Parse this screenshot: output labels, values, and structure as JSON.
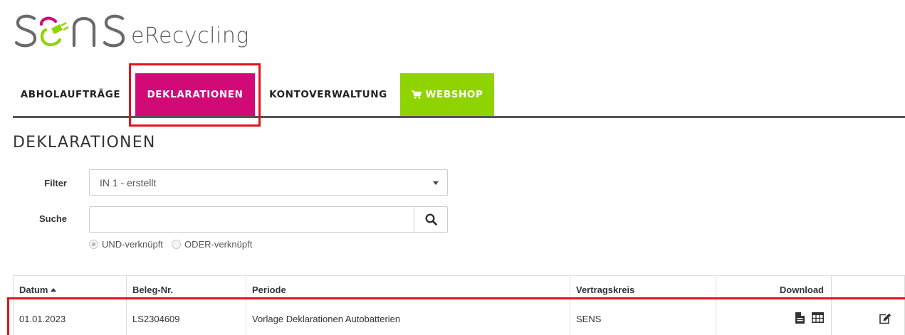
{
  "logo": {
    "name": "SENS",
    "suffix": "eRecycling",
    "colors": {
      "primary": "#6a6a6a",
      "accent_magenta": "#d20a78",
      "accent_green": "#8fd400"
    }
  },
  "nav": {
    "items": [
      {
        "label": "ABHOLAUFTRÄGE",
        "active": false
      },
      {
        "label": "DEKLARATIONEN",
        "active": true
      },
      {
        "label": "KONTOVERWALTUNG",
        "active": false
      },
      {
        "label": "WEBSHOP",
        "icon": "shopping-cart-icon",
        "active": false
      }
    ]
  },
  "page": {
    "title": "DEKLARATIONEN"
  },
  "form": {
    "filter_label": "Filter",
    "filter_value": "IN 1 - erstellt",
    "search_label": "Suche",
    "search_value": "",
    "search_placeholder": "",
    "search_icon": "search-icon",
    "radio_and": "UND-verknüpft",
    "radio_or": "ODER-verknüpft",
    "radio_selected": "UND-verknüpft"
  },
  "table": {
    "columns": [
      "Datum",
      "Beleg-Nr.",
      "Periode",
      "Vertragskreis",
      "Download",
      ""
    ],
    "sort_column": "Datum",
    "rows": [
      {
        "datum": "01.01.2023",
        "beleg": "LS2304609",
        "periode": "Vorlage Deklarationen Autobatterien",
        "vertragskreis": "SENS",
        "download_icons": [
          "file-icon",
          "table-icon"
        ],
        "action_icon": "edit-icon"
      }
    ]
  },
  "colors": {
    "highlight": "#e4131a",
    "nav_active": "#d20a78",
    "nav_shop": "#8fd400"
  }
}
